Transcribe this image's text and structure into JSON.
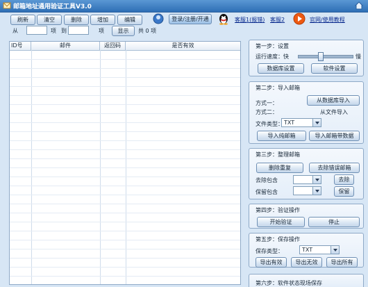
{
  "window": {
    "title": "邮箱地址通用验证工具V3.0"
  },
  "toolbar": {
    "buttons": [
      "刷新",
      "清空",
      "删除",
      "增加",
      "编辑"
    ],
    "from_label": "从",
    "from_value": "",
    "item_label_1": "项",
    "to_label": "到",
    "to_value": "",
    "item_label_2": "项",
    "show_button": "显示",
    "total_text": "共 0 项"
  },
  "top_links": {
    "login_button": "登录/注册/开通",
    "service1": "客服1(报错)",
    "service2": "客服2",
    "official": "官网/使用教程"
  },
  "table": {
    "columns": [
      "ID号",
      "邮件",
      "返回码",
      "是否有效"
    ],
    "rows": []
  },
  "step1": {
    "title": "第一步：设置",
    "speed_label": "运行速度：快",
    "speed_slow": "慢",
    "speed_level": 0.4,
    "db_button": "数据库设置",
    "soft_button": "软件设置"
  },
  "step2": {
    "title": "第二步：导入邮箱",
    "method1_label": "方式一：",
    "method1_button": "从数据库导入",
    "method2_label": "方式二：",
    "method2_text": "从文件导入",
    "filetype_label": "文件类型：",
    "filetype_value": "TXT",
    "import_pure": "导入纯邮箱",
    "import_data": "导入邮箱带数据"
  },
  "step3": {
    "title": "第三步：整理邮箱",
    "dedupe": "删除重复",
    "remove_error": "去除错误邮箱",
    "remove_contains_label": "去除包含",
    "remove_button": "去除",
    "keep_contains_label": "保留包含",
    "keep_button": "保留"
  },
  "step4": {
    "title": "第四步：验证操作",
    "start": "开始验证",
    "stop": "停止"
  },
  "step5": {
    "title": "第五步：保存操作",
    "savetype_label": "保存类型：",
    "savetype_value": "TXT",
    "export_valid": "导出有效",
    "export_invalid": "导出无效",
    "export_all": "导出所有"
  },
  "step6": {
    "title": "第六步：软件状态现场保存"
  }
}
